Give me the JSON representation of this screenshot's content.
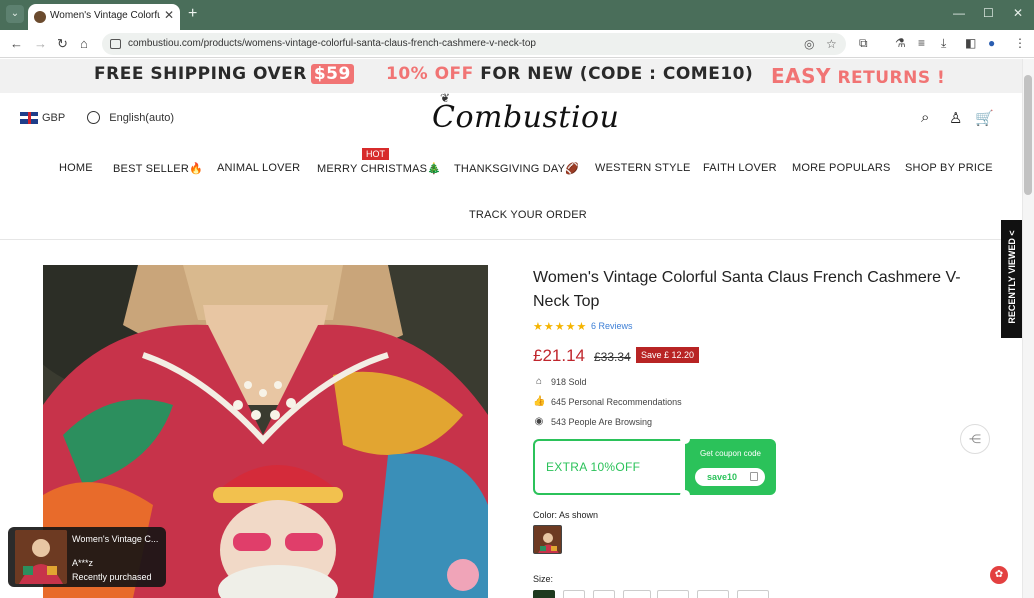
{
  "browser": {
    "tab_title": "Women's Vintage Colorful Santa",
    "url": "combustiou.com/products/womens-vintage-colorful-santa-claus-french-cashmere-v-neck-top"
  },
  "promo": {
    "shipping_prefix": "FREE SHIPPING OVER",
    "shipping_amount": "$59",
    "discount_highlight": "10% OFF",
    "discount_rest": "FOR NEW (CODE : COME10)",
    "returns_easy": "EASY",
    "returns_rest": "RETURNS !"
  },
  "header": {
    "currency": "GBP",
    "language": "English(auto)",
    "logo_text": "Combustiou"
  },
  "nav": {
    "items": [
      "HOME",
      "BEST SELLER🔥",
      "ANIMAL LOVER",
      "MERRY CHRISTMAS🎄",
      "THANKSGIVING DAY🏈",
      "WESTERN STYLE",
      "FAITH LOVER",
      "MORE POPULARS",
      "SHOP BY PRICE",
      "TRACK YOUR ORDER"
    ],
    "hot_badge": "HOT"
  },
  "product": {
    "title": "Women's Vintage Colorful Santa Claus French Cashmere V-Neck Top",
    "stars": "★★★★★",
    "reviews": "6 Reviews",
    "price": "£21.14",
    "old_price": "£33.34",
    "save": "Save £ 12.20",
    "sold": "918 Sold",
    "recommendations": "645 Personal Recommendations",
    "browsing": "543 People Are Browsing",
    "color_label": "Color: As shown",
    "size_label": "Size:"
  },
  "coupon": {
    "offer": "EXTRA 10%OFF",
    "get_label": "Get coupon code",
    "code": "save10"
  },
  "sidebar": {
    "recently_viewed": "RECENTLY VIEWED <"
  },
  "toast": {
    "product_name": "Women's Vintage C...",
    "user": "A***z",
    "status": "Recently purchased"
  }
}
